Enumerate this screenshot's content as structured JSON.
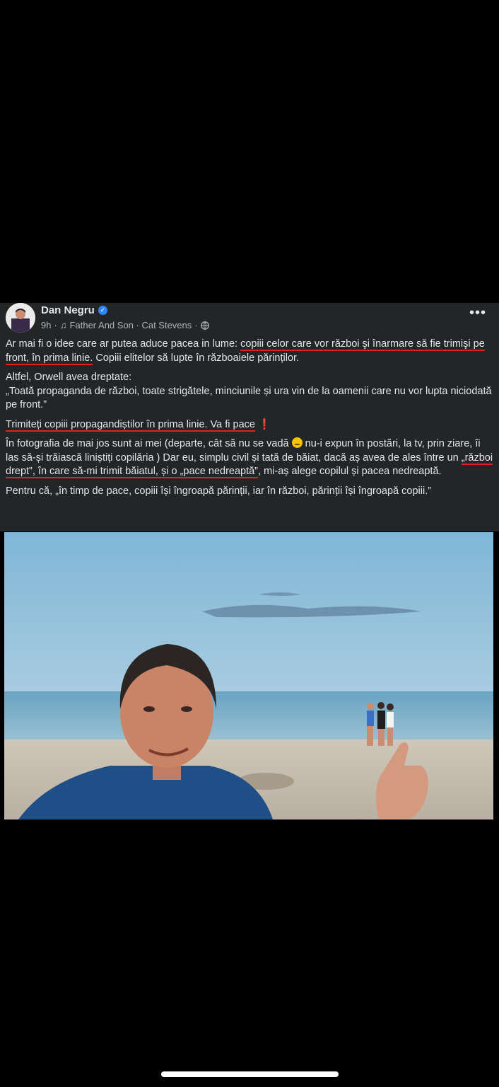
{
  "post": {
    "author": "Dan Negru",
    "time": "9h",
    "music_icon": "music-note-icon",
    "song": "Father And Son · Cat Stevens",
    "separator": "·",
    "privacy_icon": "globe-icon",
    "more_icon": "more-dots-icon",
    "more_label": "•••",
    "paragraphs": {
      "p1_a": "Ar mai fi o idee care ar putea aduce pacea in lume: ",
      "p1_ul": "copiii celor care vor război şi înarmare să fie trimişi pe front, în prima linie.",
      "p1_b": " Copiii elitelor să lupte în războaiele părinților.",
      "p2": "Altfel, Orwell avea dreptate:",
      "p2_quote": "„Toată propaganda de război, toate strigătele, minciunile și ura vin de la oamenii care nu vor lupta niciodată pe front.”",
      "p3_ul": "Trimiteți copiii propagandiștilor în prima linie. Va fi pace",
      "p3_excl": "❗",
      "p4_a": "În fotografia de mai jos sunt ai mei (departe, cât să nu se vadă ",
      "p4_b": " nu-i expun în postări, la tv, prin ziare, îi las să-și trăiască liniștiți copilăria ) Dar eu, simplu civil și tată de băiat, dacă aș avea de ales între un ",
      "p4_ul": "„război drept”, în care să-mi trimit băiatul, și o „pace nedreaptă”",
      "p4_c": ", mi-aș alege copilul și pacea nedreaptă.",
      "p5": "Pentru că, „în timp de pace, copiii își îngroapă părinții, iar în război, părinții își îngroapă copiii.”"
    },
    "emoji": "smiling-face-emoji"
  },
  "colors": {
    "background": "#000000",
    "post_bg": "#242526",
    "text": "#e4e6eb",
    "meta": "#b0b3b8",
    "underline": "#e41e26",
    "verified": "#2d88ff"
  }
}
